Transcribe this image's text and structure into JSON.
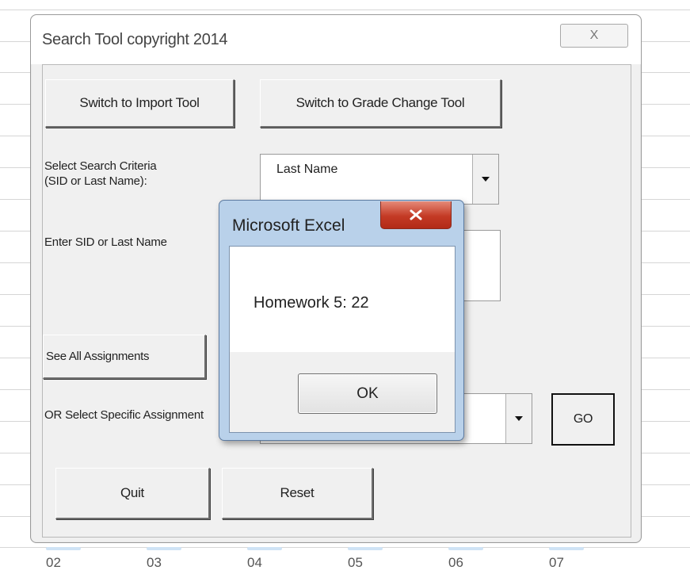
{
  "sheet": {
    "column_markers": [
      "02",
      "03",
      "04",
      "05",
      "06",
      "07"
    ]
  },
  "form": {
    "title": "Search Tool copyright 2014",
    "close_label": "X",
    "switch_import_label": "Switch to Import Tool",
    "switch_grade_label": "Switch to Grade Change Tool",
    "criteria_label_line1": "Select Search Criteria",
    "criteria_label_line2": "(SID or Last Name):",
    "criteria_value": "Last Name",
    "enter_label": "Enter SID or Last Name",
    "see_all_label": "See All Assignments",
    "select_specific_label": "OR Select Specific Assignment",
    "go_label": "GO",
    "quit_label": "Quit",
    "reset_label": "Reset"
  },
  "msgbox": {
    "title": "Microsoft Excel",
    "message": "Homework 5: 22",
    "ok_label": "OK"
  },
  "icons": [
    "close-icon",
    "dropdown-arrow-icon"
  ]
}
